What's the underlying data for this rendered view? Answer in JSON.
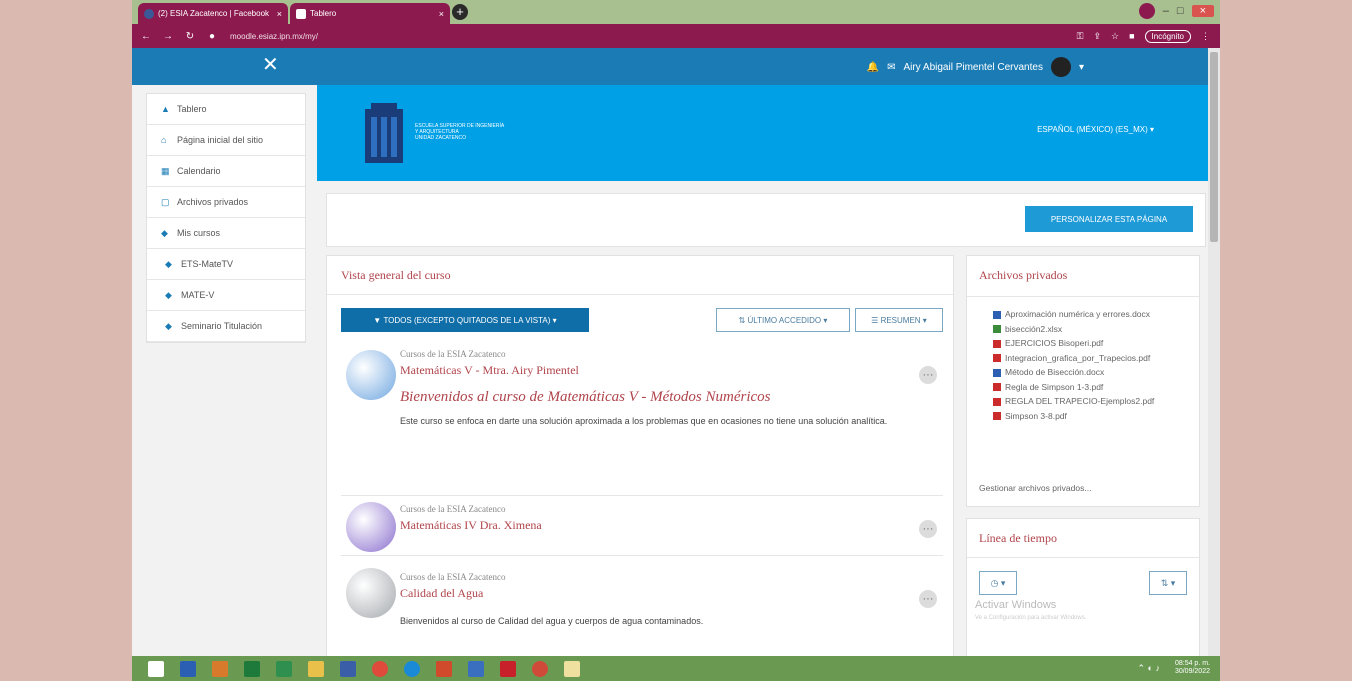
{
  "browser": {
    "tabs": [
      {
        "label": "(2) ESIA Zacatenco | Facebook",
        "close": "×"
      },
      {
        "label": "Tablero",
        "close": "×"
      }
    ],
    "new_tab": "+",
    "url": "moodle.esiaz.ipn.mx/my/",
    "incognito_label": "Incógnito"
  },
  "navbar": {
    "close": "✕",
    "user_name": "Airy Abigail Pimentel Cervantes"
  },
  "sidebar": {
    "items": [
      {
        "label": "Tablero",
        "icon": "dashboard-icon"
      },
      {
        "label": "Página inicial del sitio",
        "icon": "home-icon"
      },
      {
        "label": "Calendario",
        "icon": "calendar-icon"
      },
      {
        "label": "Archivos privados",
        "icon": "file-icon"
      },
      {
        "label": "Mis cursos",
        "icon": "graduation-cap-icon"
      },
      {
        "label": "ETS-MateTV",
        "icon": "graduation-cap-icon"
      },
      {
        "label": "MATE-V",
        "icon": "graduation-cap-icon"
      },
      {
        "label": "Seminario Titulación",
        "icon": "graduation-cap-icon"
      }
    ]
  },
  "header": {
    "school_lines": [
      "ESCUELA SUPERIOR DE INGENIERÍA",
      "Y ARQUITECTURA",
      "UNIDAD ZACATENCO"
    ],
    "language": "ESPAÑOL (MÉXICO) (ES_MX)"
  },
  "customise": {
    "label": "PERSONALIZAR ESTA PÁGINA"
  },
  "overview": {
    "title": "Vista general del curso",
    "filter_label": "TODOS (EXCEPTO QUITADOS DE LA VISTA)",
    "sort_label": "ÚLTIMO ACCEDIDO",
    "view_label": "RESUMEN",
    "courses": [
      {
        "category": "Cursos de la ESIA Zacatenco",
        "name": "Matemáticas V - Mtra. Airy Pimentel",
        "heading": "Bienvenidos al curso de Matemáticas V - Métodos Numéricos",
        "summary": "Este curso se enfoca en darte una solución aproximada a los problemas que en ocasiones no tiene una solución analítica.",
        "color": "#6fa6e0"
      },
      {
        "category": "Cursos de la ESIA Zacatenco",
        "name": "Matemáticas IV Dra. Ximena",
        "heading": "",
        "summary": "",
        "color": "#8a6fce"
      },
      {
        "category": "Cursos de la ESIA Zacatenco",
        "name": "Calidad del Agua",
        "heading": "",
        "summary": "Bienvenidos al curso de Calidad del agua y cuerpos de agua contaminados.",
        "color": "#a4a8ad"
      }
    ],
    "more": "···"
  },
  "private_files": {
    "title": "Archivos privados",
    "files": [
      {
        "name": "Aproximación numérica y errores.docx",
        "type": "doc"
      },
      {
        "name": "bisección2.xlsx",
        "type": "img"
      },
      {
        "name": "EJERCICIOS Bisoperi.pdf",
        "type": "pdf"
      },
      {
        "name": "Integracion_grafica_por_Trapecios.pdf",
        "type": "pdf"
      },
      {
        "name": "Método de Bisección.docx",
        "type": "doc"
      },
      {
        "name": "Regla de Simpson 1-3.pdf",
        "type": "pdf"
      },
      {
        "name": "REGLA DEL TRAPECIO-Ejemplos2.pdf",
        "type": "pdf"
      },
      {
        "name": "Simpson 3-8.pdf",
        "type": "pdf"
      }
    ],
    "manage": "Gestionar archivos privados..."
  },
  "timeline": {
    "title": "Línea de tiempo",
    "watermark_title": "Activar Windows",
    "watermark_sub": "Ve a Configuración para activar Windows."
  },
  "taskbar": {
    "time": "08:54 p. m.",
    "date": "30/09/2022"
  }
}
